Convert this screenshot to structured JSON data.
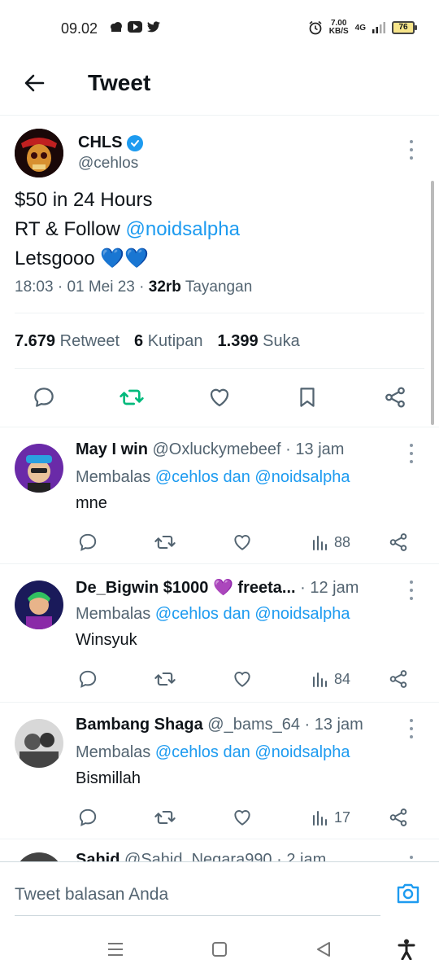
{
  "status_bar": {
    "time": "09.02",
    "net_speed": "7.00",
    "net_unit": "KB/S",
    "network": "4G",
    "battery": "76"
  },
  "header": {
    "title": "Tweet"
  },
  "tweet": {
    "author_name": "CHLS",
    "author_handle": "@cehlos",
    "line1": "$50 in 24 Hours",
    "line2_prefix": "RT & Follow ",
    "line2_mention": "@noidsalpha",
    "line3": "Letsgooo 💙💙",
    "time": "18:03",
    "date": "01 Mei 23",
    "views_count": "32rb",
    "views_label": "Tayangan",
    "retweets_count": "7.679",
    "retweets_label": "Retweet",
    "quotes_count": "6",
    "quotes_label": "Kutipan",
    "likes_count": "1.399",
    "likes_label": "Suka"
  },
  "replies": [
    {
      "name": "May I win",
      "handle": "@Oxluckymebeef",
      "time": "13 jam",
      "replying_prefix": "Membalas ",
      "replying_to": "@cehlos dan @noidsalpha",
      "text": "mne",
      "views": "88"
    },
    {
      "name": "De_Bigwin $1000 💜 freeta...",
      "handle": "",
      "time": "12 jam",
      "replying_prefix": "Membalas ",
      "replying_to": "@cehlos dan @noidsalpha",
      "text": "Winsyuk",
      "views": "84"
    },
    {
      "name": "Bambang Shaga",
      "handle": "@_bams_64",
      "time": "13 jam",
      "replying_prefix": "Membalas ",
      "replying_to": "@cehlos dan @noidsalpha",
      "text": "Bismillah",
      "views": "17"
    }
  ],
  "partial_reply": {
    "name": "Sahid",
    "handle": "@Sahid_Negara990",
    "time": "2 jam"
  },
  "reply_bar": {
    "placeholder": "Tweet balasan Anda"
  },
  "colors": {
    "accent": "#1d9bf0",
    "retweet_green": "#00ba7c",
    "muted": "#536471"
  }
}
